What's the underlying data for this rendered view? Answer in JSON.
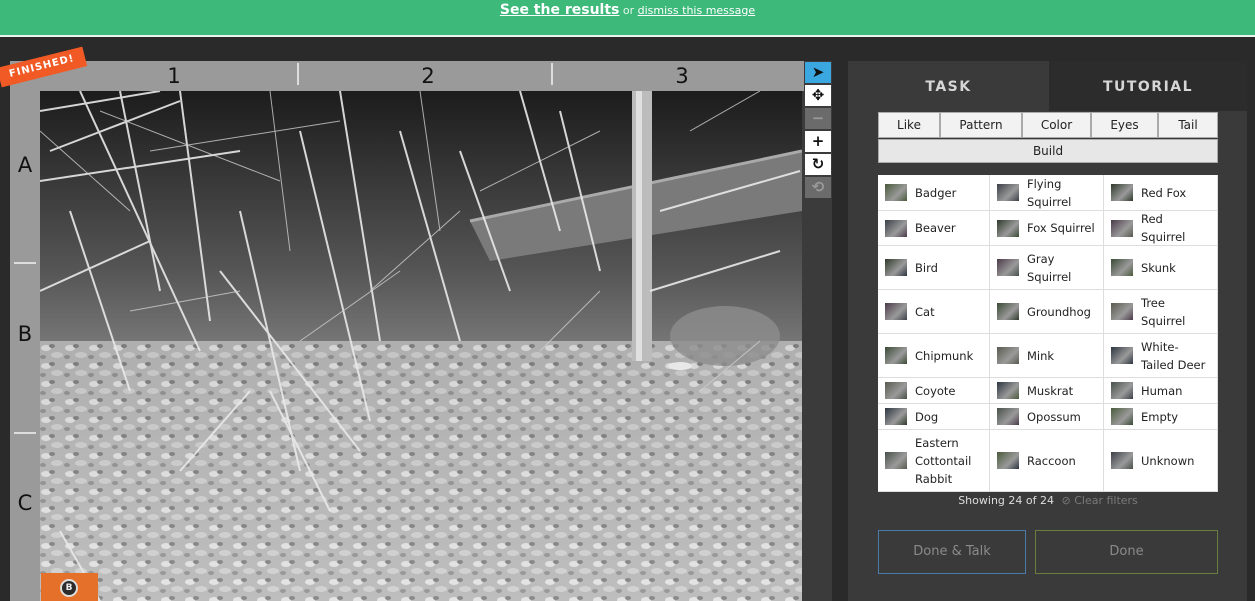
{
  "banner": {
    "results_link": "See the results",
    "or_text": "or",
    "dismiss_link": "dismiss this message"
  },
  "subject": {
    "status_badge": "FINISHED!",
    "columns": [
      "1",
      "2",
      "3"
    ],
    "rows": [
      "A",
      "B",
      "C"
    ],
    "camera_badge_glyph": "B"
  },
  "toolbar": {
    "tools": [
      {
        "name": "pointer",
        "glyph": "➤"
      },
      {
        "name": "pan",
        "glyph": "✥"
      },
      {
        "name": "zoom-out",
        "glyph": "−"
      },
      {
        "name": "zoom-in",
        "glyph": "+"
      },
      {
        "name": "rotate",
        "glyph": "↻"
      },
      {
        "name": "reset",
        "glyph": "⟲"
      }
    ]
  },
  "tabs": {
    "task": "TASK",
    "tutorial": "TUTORIAL"
  },
  "filters": {
    "items": [
      "Like",
      "Pattern",
      "Color",
      "Eyes",
      "Tail"
    ],
    "build": "Build"
  },
  "species": [
    [
      "Badger",
      "Flying Squirrel",
      "Red Fox"
    ],
    [
      "Beaver",
      "Fox Squirrel",
      "Red Squirrel"
    ],
    [
      "Bird",
      "Gray Squirrel",
      "Skunk"
    ],
    [
      "Cat",
      "Groundhog",
      "Tree Squirrel"
    ],
    [
      "Chipmunk",
      "Mink",
      "White-Tailed Deer"
    ],
    [
      "Coyote",
      "Muskrat",
      "Human"
    ],
    [
      "Dog",
      "Opossum",
      "Empty"
    ],
    [
      "Eastern Cottontail Rabbit",
      "Raccoon",
      "Unknown"
    ]
  ],
  "showing": {
    "text": "Showing 24 of 24",
    "clear": "Clear filters"
  },
  "actions": {
    "done_talk": "Done & Talk",
    "done": "Done"
  },
  "colors": {
    "banner": "#3db97a",
    "status_badge": "#f15a24",
    "active_tool": "#3aa7e0",
    "panel_bg": "#3a3a3a",
    "page_bg": "#2a2a2a"
  }
}
